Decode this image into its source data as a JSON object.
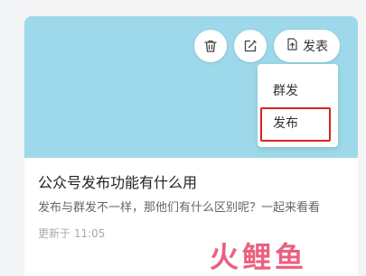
{
  "card": {
    "actions": {
      "delete_icon": "trash-icon",
      "edit_icon": "edit-icon",
      "publish_icon": "upload-doc-icon",
      "publish_label": "发表"
    },
    "menu": {
      "items": [
        {
          "label": "群发"
        },
        {
          "label": "发布"
        }
      ],
      "highlight_color": "#d9231f"
    },
    "title": "公众号发布功能有什么用",
    "description": "发布与群发不一样，那他们有什么区别呢？一起来看看",
    "updated": "更新于 11:05",
    "cover_color": "#9dd9ea"
  },
  "watermark": "火鲤鱼"
}
